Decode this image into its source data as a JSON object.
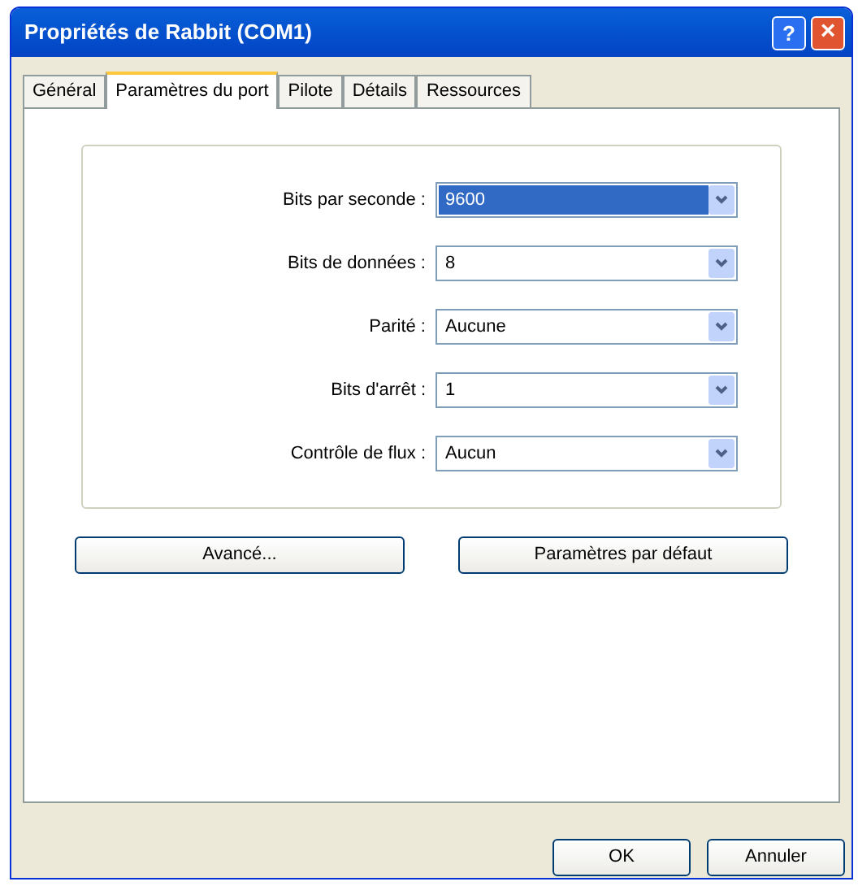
{
  "window": {
    "title": "Propriétés de Rabbit (COM1)",
    "help": "?",
    "close": "×"
  },
  "tabs": [
    {
      "label": "Général",
      "selected": false
    },
    {
      "label": "Paramètres du port",
      "selected": true
    },
    {
      "label": "Pilote",
      "selected": false
    },
    {
      "label": "Détails",
      "selected": false
    },
    {
      "label": "Ressources",
      "selected": false
    }
  ],
  "settings": [
    {
      "label": "Bits par seconde :",
      "value": "9600",
      "focused": true
    },
    {
      "label": "Bits de données :",
      "value": "8",
      "focused": false
    },
    {
      "label": "Parité :",
      "value": "Aucune",
      "focused": false
    },
    {
      "label": "Bits d'arrêt :",
      "value": "1",
      "focused": false
    },
    {
      "label": "Contrôle de flux :",
      "value": "Aucun",
      "focused": false
    }
  ],
  "panel_buttons": [
    "Avancé...",
    "Paramètres par défaut"
  ],
  "dialog_buttons": [
    "OK",
    "Annuler"
  ]
}
